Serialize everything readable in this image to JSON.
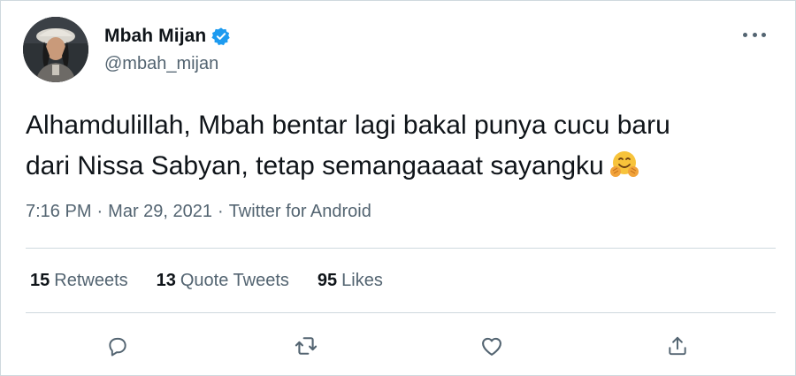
{
  "author": {
    "display_name": "Mbah Mijan",
    "handle": "@mbah_mijan",
    "verified": true
  },
  "tweet": {
    "text_line1": "Alhamdulillah, Mbah bentar lagi bakal punya cucu baru",
    "text_line2": "dari Nissa Sabyan, tetap semangaaaat sayangku",
    "emoji": "smiling-face-with-open-hands"
  },
  "meta": {
    "time": "7:16 PM",
    "separator": "·",
    "date": "Mar 29, 2021",
    "source": "Twitter for Android"
  },
  "stats": {
    "retweets_count": "15",
    "retweets_label": "Retweets",
    "quotes_count": "13",
    "quotes_label": "Quote Tweets",
    "likes_count": "95",
    "likes_label": "Likes"
  },
  "actions": [
    "reply-icon",
    "retweet-icon",
    "like-icon",
    "share-icon"
  ],
  "colors": {
    "primary_text": "#0f1419",
    "secondary_text": "#536471",
    "divider": "#cfd9de",
    "verified_blue": "#1d9bf0"
  }
}
